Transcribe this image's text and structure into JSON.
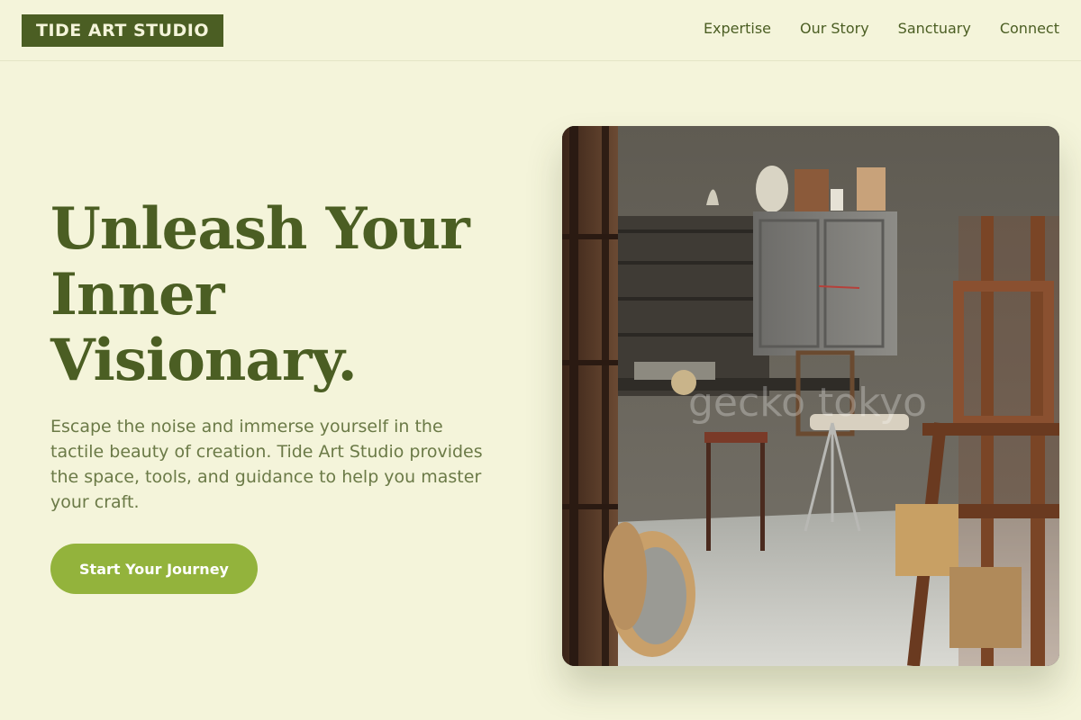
{
  "brand": {
    "name": "TIDE ART STUDIO"
  },
  "nav": {
    "items": [
      {
        "label": "Expertise"
      },
      {
        "label": "Our Story"
      },
      {
        "label": "Sanctuary"
      },
      {
        "label": "Connect"
      }
    ]
  },
  "hero": {
    "title_lines": [
      "Unleash Your",
      "Inner",
      "Visionary."
    ],
    "description": "Escape the noise and immerse yourself in the tactile beauty of creation. Tide Art Studio provides the space, tools, and guidance to help you master your craft.",
    "cta_label": "Start Your Journey",
    "image": {
      "subject": "art-studio-interior-photo",
      "watermark": "gecko tokyo"
    }
  },
  "colors": {
    "background": "#f4f4da",
    "primary_dark_green": "#4b5e23",
    "accent_green": "#93b33c",
    "muted_text": "#6b7a47"
  }
}
